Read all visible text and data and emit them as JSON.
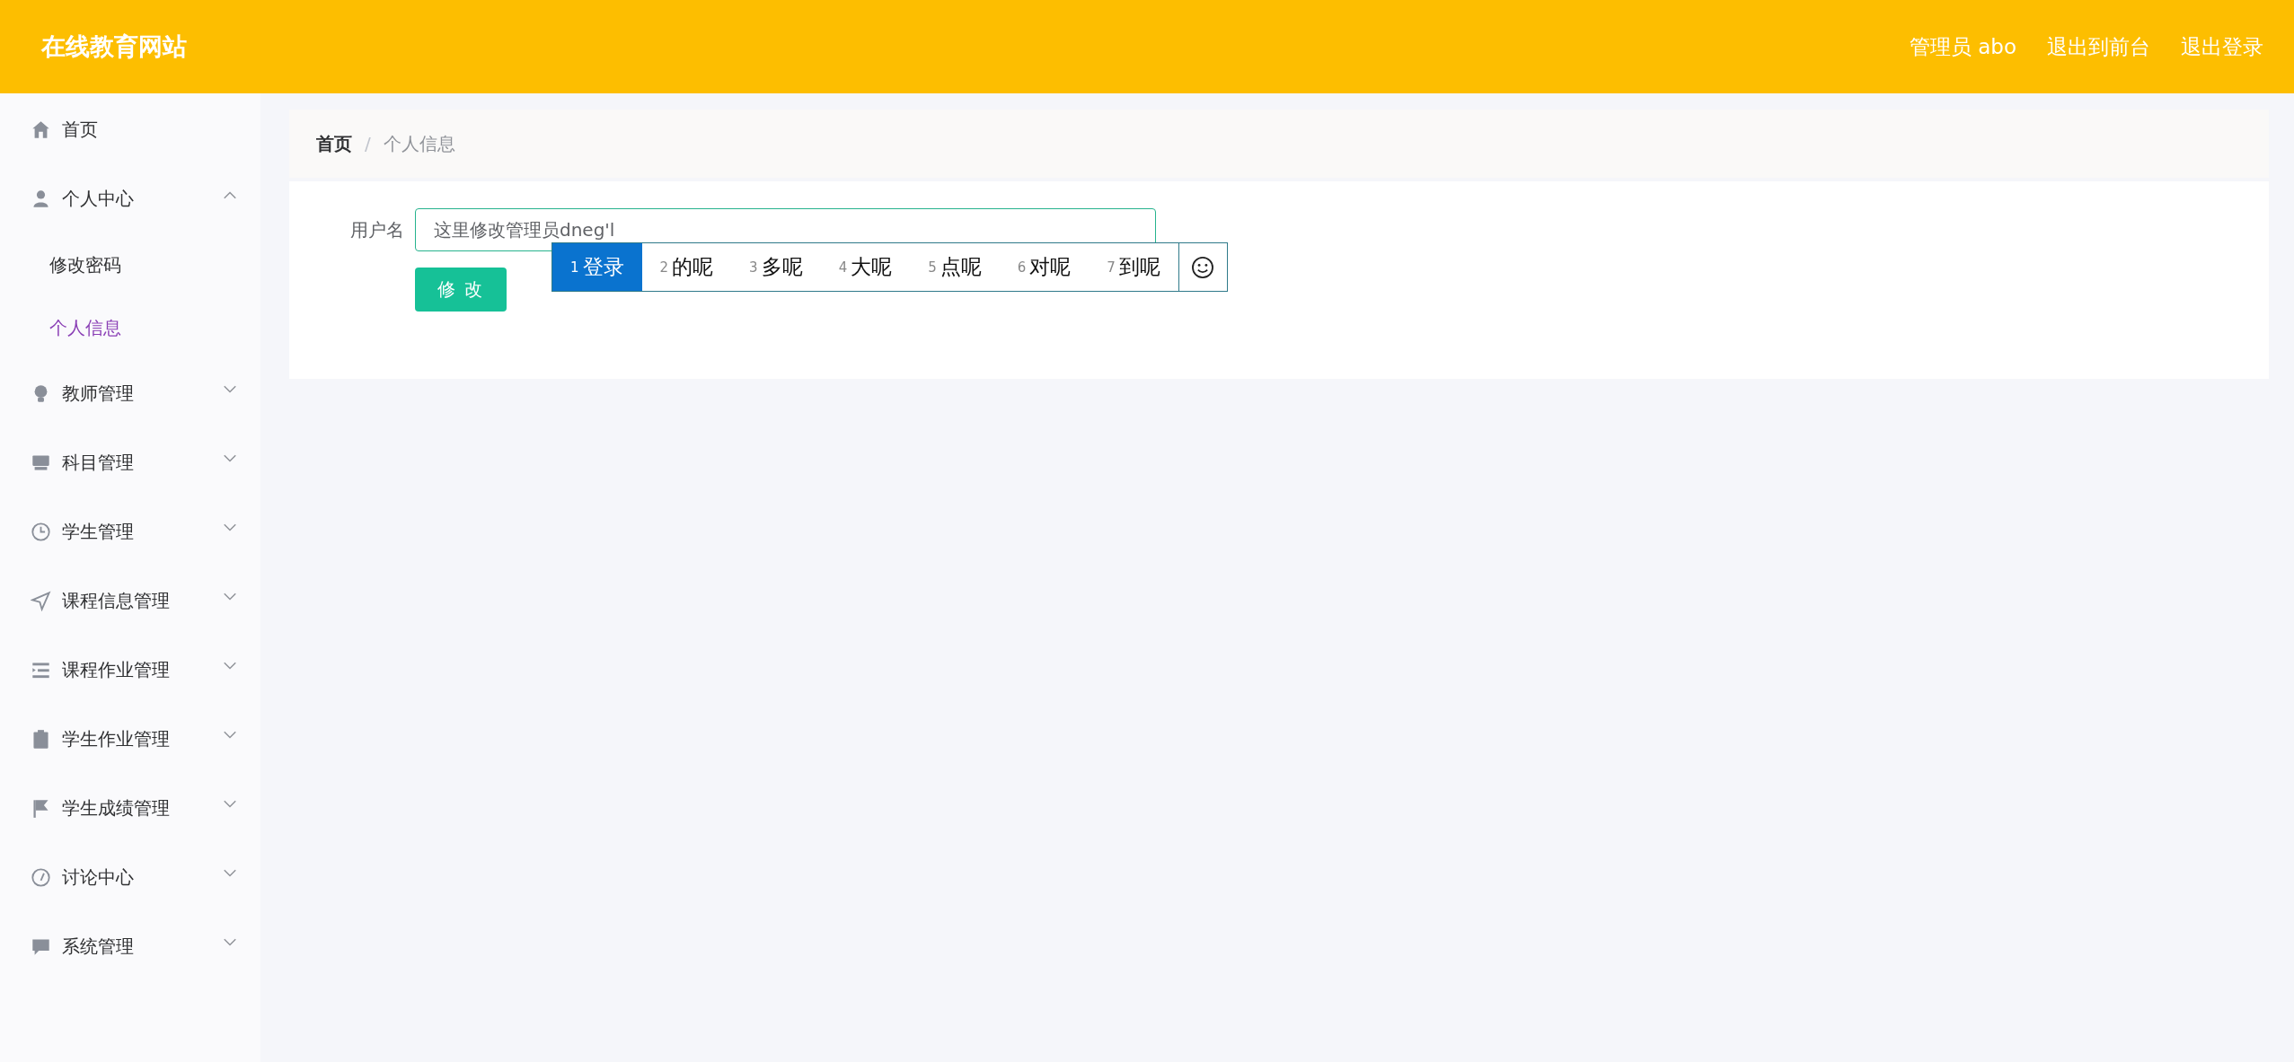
{
  "header": {
    "title": "在线教育网站",
    "links": [
      "管理员 abo",
      "退出到前台",
      "退出登录"
    ]
  },
  "sidebar": {
    "items": [
      {
        "kind": "link",
        "label": "首页"
      },
      {
        "kind": "submenu",
        "label": "个人中心",
        "expanded": true,
        "children": [
          {
            "label": "修改密码",
            "selected": false
          },
          {
            "label": "个人信息",
            "selected": true
          }
        ]
      },
      {
        "kind": "submenu",
        "label": "教师管理",
        "expanded": false
      },
      {
        "kind": "submenu",
        "label": "科目管理",
        "expanded": false
      },
      {
        "kind": "submenu",
        "label": "学生管理",
        "expanded": false
      },
      {
        "kind": "submenu",
        "label": "课程信息管理",
        "expanded": false
      },
      {
        "kind": "submenu",
        "label": "课程作业管理",
        "expanded": false
      },
      {
        "kind": "submenu",
        "label": "学生作业管理",
        "expanded": false
      },
      {
        "kind": "submenu",
        "label": "学生成绩管理",
        "expanded": false
      },
      {
        "kind": "submenu",
        "label": "讨论中心",
        "expanded": false
      },
      {
        "kind": "submenu",
        "label": "系统管理",
        "expanded": false
      }
    ]
  },
  "breadcrumb": [
    "首页",
    "/",
    "个人信息"
  ],
  "form": {
    "label": "用户名",
    "value": "这里修改管理员dneg'l",
    "button": "修 改"
  },
  "ime": {
    "candidates": [
      {
        "index": "1",
        "text": "登录",
        "selected": true
      },
      {
        "index": "2",
        "text": "的呢",
        "selected": false
      },
      {
        "index": "3",
        "text": "多呢",
        "selected": false
      },
      {
        "index": "4",
        "text": "大呢",
        "selected": false
      },
      {
        "index": "5",
        "text": "点呢",
        "selected": false
      },
      {
        "index": "6",
        "text": "对呢",
        "selected": false
      },
      {
        "index": "7",
        "text": "到呢",
        "selected": false
      }
    ]
  }
}
